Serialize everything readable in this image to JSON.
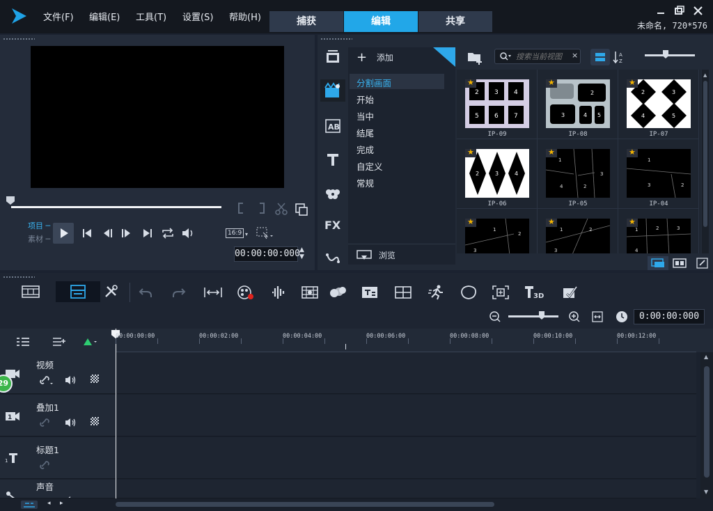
{
  "menu": {
    "file": "文件(F)",
    "edit": "编辑(E)",
    "tools": "工具(T)",
    "settings": "设置(S)",
    "help": "帮助(H)"
  },
  "tabs": {
    "capture": "捕获",
    "edit": "编辑",
    "share": "共享"
  },
  "project_info": "未命名, 720*576",
  "preview": {
    "mode_project": "项目",
    "mode_clip": "素材",
    "aspect": "16:9",
    "timecode": "00:00:00:000"
  },
  "library": {
    "add_label": "添加",
    "search_placeholder": "搜索当前视图",
    "browse_label": "浏览",
    "categories": [
      "分割画面",
      "开始",
      "当中",
      "结尾",
      "完成",
      "自定义",
      "常规"
    ],
    "thumbnails": [
      "IP-09",
      "IP-08",
      "IP-07",
      "IP-06",
      "IP-05",
      "IP-04",
      "",
      "",
      ""
    ]
  },
  "timeline": {
    "timecode": "0:00:00:000",
    "ruler_ticks": [
      "00:00:00:00",
      "00:00:02:00",
      "00:00:04:00",
      "00:00:06:00",
      "00:00:08:00",
      "00:00:10:00",
      "00:00:12:00"
    ],
    "tracks": [
      {
        "name": "视频"
      },
      {
        "name": "叠加1"
      },
      {
        "name": "标题1"
      },
      {
        "name": "声音"
      }
    ],
    "badge": "29"
  }
}
